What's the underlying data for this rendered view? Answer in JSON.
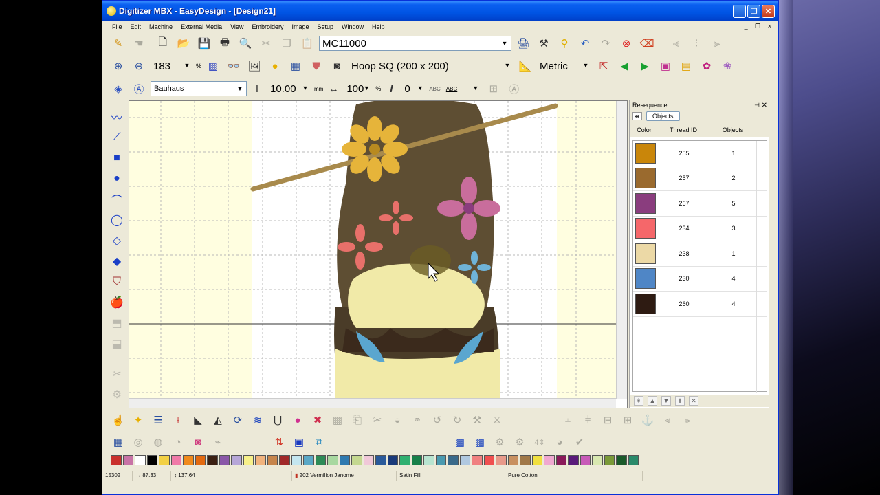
{
  "window": {
    "title": "Digitizer MBX - EasyDesign - [Design21]",
    "controls": [
      "_",
      "❐",
      "✕"
    ]
  },
  "menu": [
    "File",
    "Edit",
    "Machine",
    "External Media",
    "View",
    "Embroidery",
    "Image",
    "Setup",
    "Window",
    "Help"
  ],
  "mdi_controls": "_ ❐ ×",
  "toolbar1": {
    "machine_value": "MC11000"
  },
  "toolbar2": {
    "zoom_value": "183",
    "zoom_unit": "%",
    "hoop_value": "Hoop SQ (200 x 200)",
    "units_value": "Metric"
  },
  "toolbar3": {
    "font_value": "Bauhaus",
    "height_value": "10.00",
    "height_unit": "mm",
    "width_value": "100",
    "width_unit": "%",
    "italic_value": "0",
    "abc1": "ABC",
    "abc2": "ABC"
  },
  "panel": {
    "title": "Resequence",
    "pin": "⊣",
    "close": "✕",
    "tab": "Objects",
    "col_color": "Color",
    "col_thread": "Thread ID",
    "col_objects": "Objects",
    "threads": [
      {
        "color": "#c9860a",
        "thread_id": "255",
        "objects": "1"
      },
      {
        "color": "#9a6a2e",
        "thread_id": "257",
        "objects": "2"
      },
      {
        "color": "#8a3d7e",
        "thread_id": "267",
        "objects": "5"
      },
      {
        "color": "#f5676a",
        "thread_id": "234",
        "objects": "3"
      },
      {
        "color": "#ecd9a6",
        "thread_id": "238",
        "objects": "1"
      },
      {
        "color": "#4f86c6",
        "thread_id": "230",
        "objects": "4"
      },
      {
        "color": "#2e1b12",
        "thread_id": "260",
        "objects": "4"
      }
    ]
  },
  "palette": [
    "#c9302c",
    "#c873a6",
    "#ffffff",
    "#000000",
    "#f2d043",
    "#f07aa8",
    "#f08a1c",
    "#e36a10",
    "#3b2012",
    "#8a57a8",
    "#b6a6d8",
    "#f7f08a",
    "#f1b37d",
    "#c6854c",
    "#a02828",
    "#c4e6ef",
    "#5aa8c6",
    "#2e8b57",
    "#a8d8a0",
    "#2f7ab0",
    "#c4d890",
    "#f0c8d8",
    "#2a5a9a",
    "#1a3a7a",
    "#30b070",
    "#18804a",
    "#b8e4d0",
    "#4a9ab0",
    "#3a6a8a",
    "#b0c8e0",
    "#f08080",
    "#f05050",
    "#e89a8a",
    "#c89060",
    "#a07848",
    "#f0e040",
    "#f0a8d0",
    "#8a1a5a",
    "#5a1a7a",
    "#c85ab8",
    "#d8e8b0",
    "#7a9a38",
    "#1a5a2a",
    "#2a8a6a"
  ],
  "status": {
    "stitches": "15302",
    "width": "87.33",
    "height": "137.64",
    "thread": "202 Vermilion Janome",
    "fill": "Satin Fill",
    "material": "Pure Cotton"
  }
}
